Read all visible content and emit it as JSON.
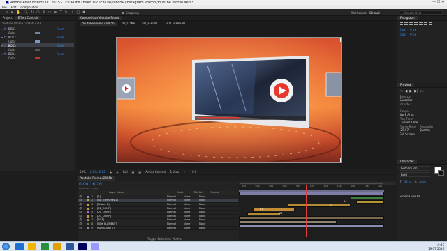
{
  "window": {
    "title": "Adobe After Effects CC 2015 - D:\\ПРОЕКТЫ\\AE ПРОЕКТЫ\\Работы\\Instagram Promo\\Youtube Promo.aep *"
  },
  "menu": [
    "File",
    "Edit",
    "Composition"
  ],
  "toolbar": {
    "snapping": "Snapping",
    "workspace_label": "Workspace:",
    "workspace_value": "Default",
    "search_placeholder": "Search Help"
  },
  "project": {
    "tabs": [
      "Project",
      "Effect Controls"
    ],
    "header": "Youtube Promo.r2085b • 03",
    "layers": [
      {
        "name": "BOX1",
        "prop": "Color",
        "swatch": "#6e86a0",
        "value": "Reset"
      },
      {
        "name": "BOX2",
        "prop": "Color",
        "swatch": "#7d9ab8",
        "value": "Reset"
      },
      {
        "name": "BOX3",
        "prop": "Color",
        "swatch": "#101010",
        "value": "Reset"
      },
      {
        "name": "BOX4",
        "prop": "Color",
        "swatch": "#c3302a",
        "value": "Reset"
      }
    ]
  },
  "composition": {
    "tab": "Composition Youtube Promo",
    "subtabs": [
      "Youtube Promo.r2085b",
      "02_COMP",
      "01_B-ROLL",
      "BOX ELEMENT"
    ],
    "footer": {
      "zoom": "50%",
      "timecode": "0;00;16;26",
      "quality": "Full",
      "camera": "Active Camera",
      "views": "1 View",
      "exposure": "+0.0"
    }
  },
  "timeline": {
    "tab": "Youtube Promo.r2085b",
    "timecode": "0;00;16;26",
    "fps": "00506 (29.97 fps)",
    "columns": {
      "name": "Layer Name",
      "mode": "Mode",
      "trkmat": "TrkMat",
      "parent": "Parent"
    },
    "ruler": [
      "00s",
      "02s",
      "04s",
      "06s",
      "08s",
      "10s",
      "12s",
      "14s",
      "16s",
      "18s",
      "20s"
    ],
    "layers": [
      {
        "num": "1",
        "name": "[1]",
        "mode": "Normal",
        "trk": "None",
        "parent": "None",
        "sel": false
      },
      {
        "num": "2",
        "name": "[BG_Elements 1]",
        "mode": "Normal",
        "trk": "None",
        "parent": "None",
        "sel": true
      },
      {
        "num": "3",
        "name": "[Shape 1]",
        "mode": "Normal",
        "trk": "None",
        "parent": "None",
        "sel": false
      },
      {
        "num": "4",
        "name": "[02_COMP]",
        "mode": "Normal",
        "trk": "None",
        "parent": "None",
        "sel": false
      },
      {
        "num": "5",
        "name": "[01_COMP]",
        "mode": "Normal",
        "trk": "None",
        "parent": "None",
        "sel": false
      },
      {
        "num": "6",
        "name": "[03_COMP]",
        "mode": "Normal",
        "trk": "None",
        "parent": "None",
        "sel": false
      },
      {
        "num": "7",
        "name": "[BG1]",
        "mode": "Normal",
        "trk": "None",
        "parent": "None",
        "sel": false
      },
      {
        "num": "8",
        "name": "[BOX ELEMENT]",
        "mode": "Normal",
        "trk": "None",
        "parent": "None",
        "sel": false
      },
      {
        "num": "9",
        "name": "[ADJ SOLID 1]",
        "mode": "Normal",
        "trk": "None",
        "parent": "None",
        "sel": false
      }
    ],
    "bar_labels": [
      "02",
      "04",
      "03",
      "01"
    ],
    "footer": "Toggle Switches / Modes"
  },
  "right": {
    "paragraph_tab": "Paragraph",
    "preview_tab": "Preview",
    "preview": {
      "shortcut_label": "Shortcut",
      "shortcut_value": "Spacebar",
      "include_label": "Include:",
      "loop_label": "Range",
      "loop_value": "Work Area",
      "play_from_label": "Play From",
      "play_from_value": "Current Time",
      "frame_rate_label": "Frame Rate",
      "frame_rate_value": "(29.97)",
      "resolution_label": "Resolution",
      "resolution_value": "Quarter",
      "full_screen": "Full Screen"
    },
    "character_tab": "Character",
    "character": {
      "font": "Gotham Pro",
      "style": "Bold",
      "size": "53 px",
      "leading": "Auto",
      "stroke": "Stroke Over Fill"
    }
  },
  "taskbar": {
    "time": "19:47",
    "date": "19.07.2019",
    "icons": [
      "#1f6fd0",
      "#f3b400",
      "#2a8f3a",
      "#e0a000",
      "#2b579a",
      "#00005b",
      "#9999ff"
    ]
  }
}
